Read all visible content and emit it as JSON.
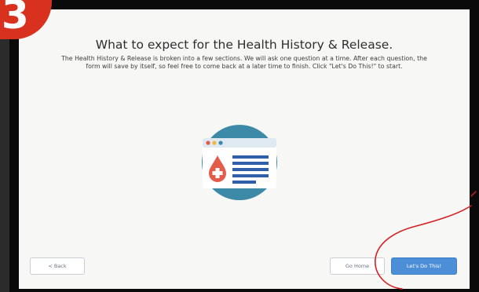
{
  "step_badge": {
    "number": "3"
  },
  "page": {
    "title": "What to expect for the Health History & Release.",
    "intro_line1": "The Health History & Release is broken into a few sections. We will ask one question at a time. After each question, the",
    "intro_line2": "form will save by itself, so feel free to come back at a later time to finish. Click \"Let's Do This!\" to start."
  },
  "buttons": {
    "back": "< Back",
    "home": "Go Home",
    "start": "Let's Do This!"
  },
  "colors": {
    "badge": "#d8321f",
    "primary_button": "#4c8fd6",
    "illustration_circle": "#3c8aa8",
    "drop": "#e45b4a",
    "annotation_circle": "#d42020"
  },
  "icons": {
    "illustration": "health-form-illustration-icon",
    "medical_drop": "blood-drop-cross-icon"
  }
}
